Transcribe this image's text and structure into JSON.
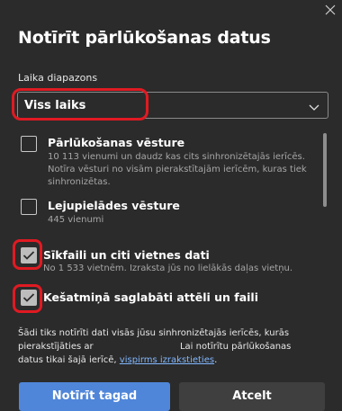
{
  "dialog": {
    "title": "Notīrīt pārlūkošanas datus",
    "time_range": {
      "label": "Laika diapazons",
      "selected": "Viss laiks"
    },
    "items": [
      {
        "title": "Pārlūkošanas vēsture",
        "description": "10 113 vienumi un daudz kas cits sinhronizētajās ierīcēs. Notīra vēsturi no visām pierakstītajām ierīcēm, kuras tiek sinhronizētas.",
        "checked": false
      },
      {
        "title": "Lejupielādes vēsture",
        "description": "445 vienumi",
        "checked": false
      },
      {
        "title": "Sīkfaili un citi vietnes dati",
        "description": "No 1 533 vietnēm. Izraksta jūs no lielākās daļas vietņu.",
        "checked": true
      },
      {
        "title": "Kešatmiņā saglabāti attēli un faili",
        "description": "",
        "checked": true
      }
    ],
    "footer": {
      "text_part1": "Šādi tiks notīrīti dati visās jūsu sinhronizētajās ierīcēs, kurās pierakstījāties ar",
      "text_part2": "Lai notīrītu pārlūkošanas datus tikai šajā ierīcē,",
      "link": "vispirms izrakstieties",
      "text_part3": "."
    },
    "buttons": {
      "primary": "Notīrīt tagad",
      "secondary": "Atcelt"
    },
    "colors": {
      "dialog_bg": "#2b2b2b",
      "primary_button": "#4f86d9",
      "secondary_button": "#3f3f3f",
      "highlight": "#e01a22",
      "link": "#82b8ff"
    }
  }
}
